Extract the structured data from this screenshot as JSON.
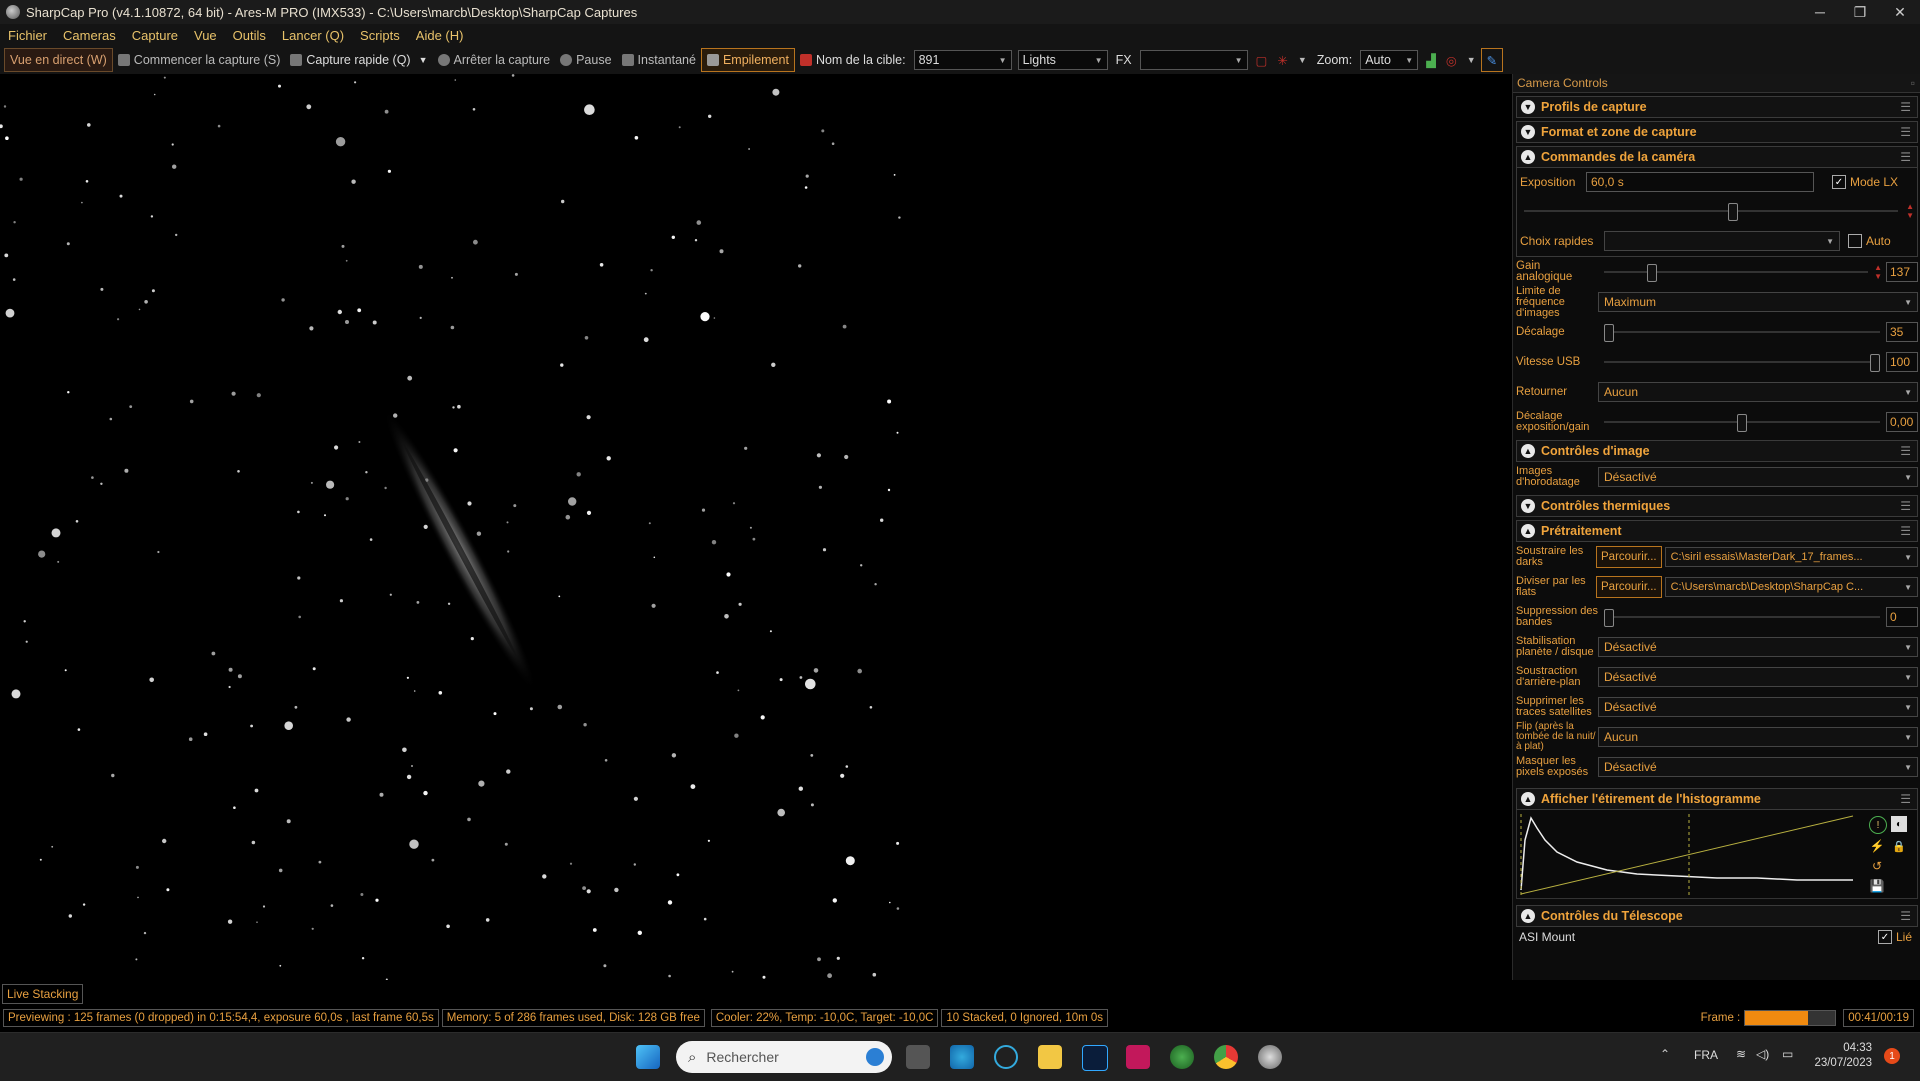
{
  "window": {
    "title": "SharpCap Pro (v4.1.10872, 64 bit) - Ares-M PRO (IMX533) - C:\\Users\\marcb\\Desktop\\SharpCap Captures",
    "min": "─",
    "max": "❐",
    "close": "✕"
  },
  "menu": [
    "Fichier",
    "Cameras",
    "Capture",
    "Vue",
    "Outils",
    "Lancer (Q)",
    "Scripts",
    "Aide (H)"
  ],
  "toolbar": {
    "live_view": "Vue en direct (W)",
    "start_capture": "Commencer la capture (S)",
    "quick_capture": "Capture rapide (Q)",
    "stop_capture": "Arrêter la capture",
    "pause": "Pause",
    "snapshot": "Instantané",
    "stacking": "Empilement",
    "target_label": "Nom de la cible:",
    "target_value": "891",
    "frame_type": "Lights",
    "fx_label": "FX",
    "fx_value": "",
    "zoom_label": "Zoom:",
    "zoom_value": "Auto"
  },
  "panel": {
    "title": "Camera Controls",
    "sections": {
      "profiles": "Profils de capture",
      "format": "Format et zone de capture",
      "camera": "Commandes de la caméra",
      "image": "Contrôles d'image",
      "thermal": "Contrôles thermiques",
      "preprocessing": "Prétraitement",
      "histogram": "Afficher l'étirement de l'histogramme",
      "telescope": "Contrôles du Télescope"
    },
    "camera": {
      "exposure_label": "Exposition",
      "exposure_value": "60,0 s",
      "lx_mode": "Mode LX",
      "lx_checked": true,
      "quick_choices_label": "Choix rapides",
      "auto_label": "Auto",
      "gain_label": "Gain analogique",
      "gain_value": "137",
      "gain_fraction": 0.17,
      "framerate_label": "Limite de fréquence d'images",
      "framerate_value": "Maximum",
      "offset_label": "Décalage",
      "offset_value": "35",
      "offset_fraction": 0.0,
      "usb_label": "Vitesse USB",
      "usb_value": "100",
      "usb_fraction": 1.0,
      "flip_label": "Retourner",
      "flip_value": "Aucun",
      "expgain_label": "Décalage exposition/gain",
      "expgain_value": "0,00",
      "expgain_fraction": 0.5
    },
    "image": {
      "timestamp_label": "Images d'horodatage",
      "timestamp_value": "Désactivé"
    },
    "preprocessing": {
      "darks_label": "Soustraire les darks",
      "browse": "Parcourir...",
      "darks_path": "C:\\siril essais\\MasterDark_17_frames...",
      "flats_label": "Diviser par les flats",
      "flats_path": "C:\\Users\\marcb\\Desktop\\SharpCap C...",
      "banding_label": "Suppression des bandes",
      "banding_value": "0",
      "stabilize_label": "Stabilisation planète / disque",
      "stabilize_value": "Désactivé",
      "background_label": "Soustraction d'arrière-plan",
      "background_value": "Désactivé",
      "satellite_label": "Supprimer les traces satellites",
      "satellite_value": "Désactivé",
      "flip_after_label": "Flip (après la tombée de la nuit/à plat)",
      "flip_after_value": "Aucun",
      "hotpixels_label": "Masquer les pixels exposés",
      "hotpixels_value": "Désactivé"
    },
    "telescope": {
      "mount": "ASI Mount",
      "linked_label": "Lié",
      "linked": true
    }
  },
  "live_stacking_tab": "Live Stacking",
  "status": {
    "preview": "Previewing : 125 frames (0 dropped) in 0:15:54,4, exposure 60,0s , last frame 60,5s",
    "memory": "Memory: 5 of 286 frames used, Disk: 128 GB free",
    "cooler": "Cooler: 22%, Temp: -10,0C, Target: -10,0C",
    "stacked": "10 Stacked, 0 Ignored, 10m 0s",
    "frame_label": "Frame :",
    "frame_progress": 0.7,
    "time": "00:41/00:19"
  },
  "taskbar": {
    "search_placeholder": "Rechercher",
    "lang": "FRA",
    "clock_time": "04:33",
    "clock_date": "23/07/2023",
    "notif_count": "1"
  },
  "colors": {
    "accent_orange": "#e8a040",
    "section_orange": "#f0a43c",
    "panel_bg": "#0c0c0c"
  }
}
